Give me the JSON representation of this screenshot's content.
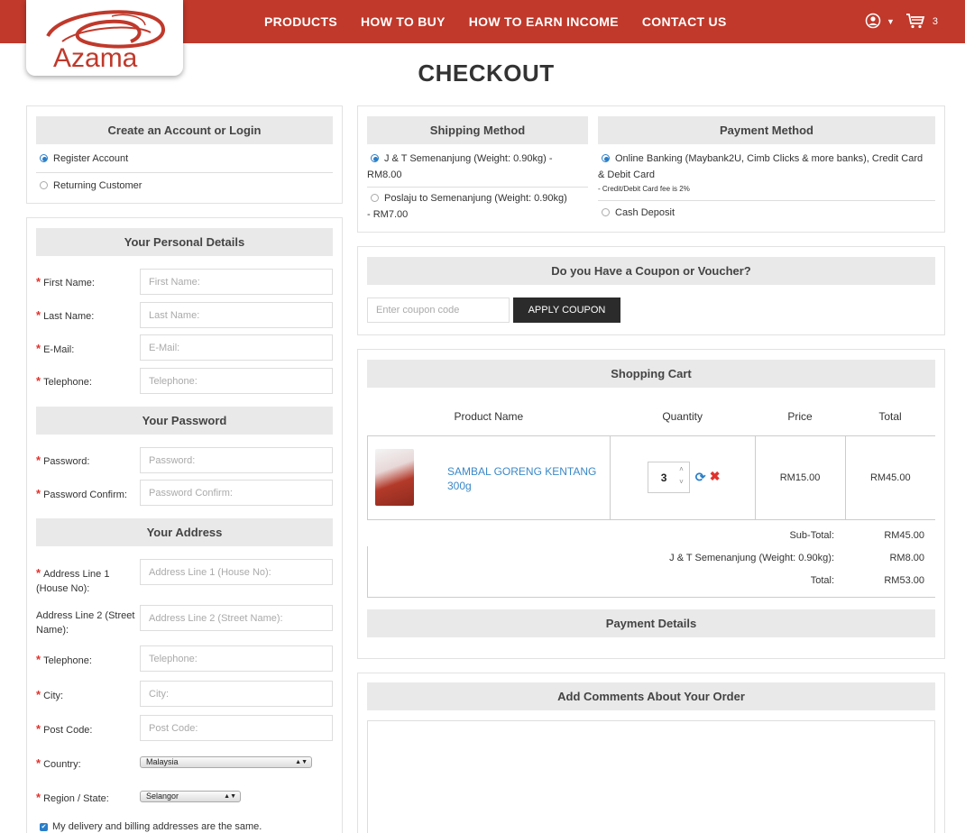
{
  "brand": {
    "logo_text": "Azama"
  },
  "nav": {
    "items": [
      "PRODUCTS",
      "HOW TO BUY",
      "HOW TO EARN INCOME",
      "CONTACT US"
    ],
    "cart_count": "3"
  },
  "page_title": "CHECKOUT",
  "account": {
    "title": "Create an Account or Login",
    "options": [
      "Register Account",
      "Returning Customer"
    ]
  },
  "personal": {
    "title": "Your Personal Details",
    "first_name": {
      "label": "First Name:",
      "placeholder": "First Name:"
    },
    "last_name": {
      "label": "Last Name:",
      "placeholder": "Last Name:"
    },
    "email": {
      "label": "E-Mail:",
      "placeholder": "E-Mail:"
    },
    "telephone": {
      "label": "Telephone:",
      "placeholder": "Telephone:"
    }
  },
  "password": {
    "title": "Your Password",
    "password": {
      "label": "Password:",
      "placeholder": "Password:"
    },
    "confirm": {
      "label": "Password Confirm:",
      "placeholder": "Password Confirm:"
    }
  },
  "address": {
    "title": "Your Address",
    "line1": {
      "label": "Address Line 1 (House No):",
      "placeholder": "Address Line 1 (House No):"
    },
    "line2": {
      "label": "Address Line 2 (Street Name):",
      "placeholder": "Address Line 2 (Street Name):"
    },
    "telephone": {
      "label": "Telephone:",
      "placeholder": "Telephone:"
    },
    "city": {
      "label": "City:",
      "placeholder": "City:"
    },
    "postcode": {
      "label": "Post Code:",
      "placeholder": "Post Code:"
    },
    "country": {
      "label": "Country:",
      "value": "Malaysia"
    },
    "region": {
      "label": "Region / State:",
      "value": "Selangor"
    },
    "same_address": "My delivery and billing addresses are the same."
  },
  "shipping": {
    "title": "Shipping Method",
    "options": [
      {
        "line1": "J & T Semenanjung (Weight: 0.90kg) -",
        "line2": "RM8.00"
      },
      {
        "line1": "Poslaju to Semenanjung (Weight: 0.90kg)",
        "line2": "- RM7.00"
      }
    ]
  },
  "payment": {
    "title": "Payment Method",
    "options": [
      {
        "line1": "Online Banking (Maybank2U, Cimb Clicks & more banks), Credit Card",
        "line2": "& Debit Card",
        "note": "- Credit/Debit Card fee is 2%"
      },
      {
        "line1": "Cash Deposit"
      }
    ]
  },
  "coupon": {
    "title": "Do you Have a Coupon or Voucher?",
    "placeholder": "Enter coupon code",
    "button": "APPLY COUPON"
  },
  "cart": {
    "title": "Shopping Cart",
    "headers": [
      "Product Name",
      "Quantity",
      "Price",
      "Total"
    ],
    "item": {
      "name": "SAMBAL GORENG KENTANG 300g",
      "qty": "3",
      "price": "RM15.00",
      "total": "RM45.00"
    },
    "totals": [
      {
        "label": "Sub-Total:",
        "value": "RM45.00"
      },
      {
        "label": "J & T Semenanjung (Weight: 0.90kg):",
        "value": "RM8.00"
      },
      {
        "label": "Total:",
        "value": "RM53.00"
      }
    ]
  },
  "payment_details": {
    "title": "Payment Details"
  },
  "comments": {
    "title": "Add Comments About Your Order"
  },
  "colors": {
    "brand_red": "#c0392b",
    "accent_blue": "#2a7ec9",
    "required_red": "#e0332d"
  }
}
